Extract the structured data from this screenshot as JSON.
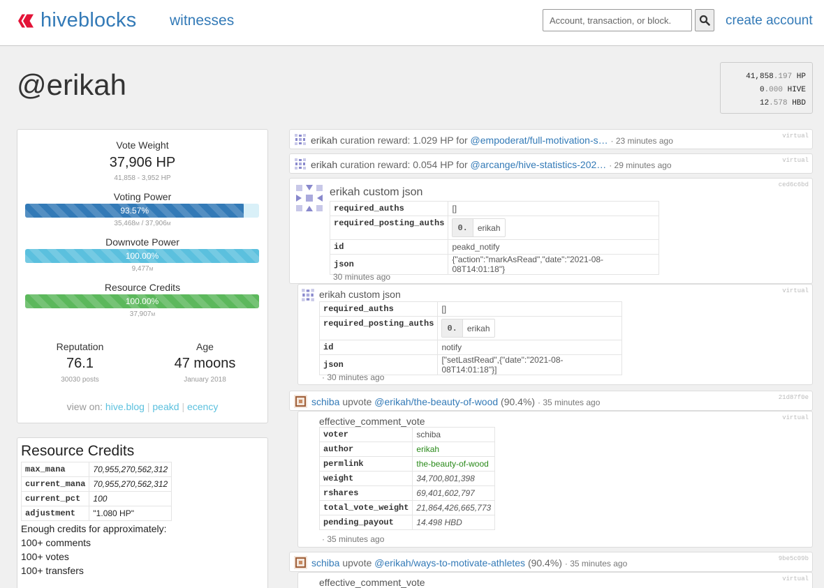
{
  "header": {
    "brand": "hiveblocks",
    "nav_witnesses": "witnesses",
    "search_placeholder": "Account, transaction, or block.",
    "create_account": "create account"
  },
  "account": {
    "username": "@erikah"
  },
  "balances": [
    {
      "int": "41,858",
      "dec": ".197",
      "unit": "HP"
    },
    {
      "int": "0",
      "dec": ".000",
      "unit": "HIVE"
    },
    {
      "int": "12",
      "dec": ".578",
      "unit": "HBD"
    }
  ],
  "stats": {
    "vote_weight_label": "Vote Weight",
    "vote_weight": "37,906 HP",
    "vote_weight_sub": "41,858 - 3,952 HP",
    "voting_power_label": "Voting Power",
    "voting_power_pct": 93.57,
    "voting_power_text": "93.57%",
    "voting_power_sub_a": "35,468",
    "voting_power_sub_b": "37,906",
    "downvote_power_label": "Downvote Power",
    "downvote_power_pct": 100,
    "downvote_power_text": "100.00%",
    "downvote_power_sub": "9,477",
    "rc_label": "Resource Credits",
    "rc_pct": 100,
    "rc_text": "100.00%",
    "rc_sub": "37,907",
    "unit_symbol": "M",
    "reputation_label": "Reputation",
    "reputation": "76.1",
    "posts": "30030 posts",
    "age_label": "Age",
    "age": "47 moons",
    "joined": "January 2018",
    "view_on": "view on:",
    "links": [
      "hive.blog",
      "peakd",
      "ecency"
    ]
  },
  "resource_credits": {
    "title": "Resource Credits",
    "rows": [
      {
        "k": "max_mana",
        "v": "70,955,270,562,312"
      },
      {
        "k": "current_mana",
        "v": "70,955,270,562,312"
      },
      {
        "k": "current_pct",
        "v": "100"
      },
      {
        "k": "adjustment",
        "v": "\"1.080 HP\""
      }
    ],
    "enough": "Enough credits for approximately:",
    "comments": "100+ comments",
    "votes": "100+ votes",
    "transfers": "100+ transfers"
  },
  "ops": {
    "op1": {
      "account": "erikah",
      "text": "curation reward: 1.029 HP for",
      "link": "@empoderat/full-motivation-s…",
      "age": "23 minutes ago",
      "tag": "virtual"
    },
    "op2": {
      "account": "erikah",
      "text": "curation reward: 0.054 HP for",
      "link": "@arcange/hive-statistics-202…",
      "age": "29 minutes ago",
      "tag": "virtual"
    },
    "op3": {
      "account": "erikah",
      "type": "custom json",
      "tag": "ced6c6bd",
      "rows": [
        {
          "k": "required_auths",
          "v": "[]"
        },
        {
          "k": "required_posting_auths",
          "badge_n": "0.",
          "badge_v": "erikah"
        },
        {
          "k": "id",
          "v": "peakd_notify"
        },
        {
          "k": "json",
          "v": "{\"action\":\"markAsRead\",\"date\":\"2021-08-08T14:01:18\"}"
        }
      ],
      "age": "30 minutes ago"
    },
    "op4": {
      "account": "erikah",
      "type": "custom json",
      "tag": "virtual",
      "rows": [
        {
          "k": "required_auths",
          "v": "[]"
        },
        {
          "k": "required_posting_auths",
          "badge_n": "0.",
          "badge_v": "erikah"
        },
        {
          "k": "id",
          "v": "notify"
        },
        {
          "k": "json",
          "v": "[\"setLastRead\",{\"date\":\"2021-08-08T14:01:18\"}]"
        }
      ],
      "age": "· 30 minutes ago"
    },
    "op5": {
      "account": "schiba",
      "action": "upvote",
      "link": "@erikah/the-beauty-of-wood",
      "pct": "(90.4%)",
      "age": "35 minutes ago",
      "tag": "21d87f0e"
    },
    "op6": {
      "title": "effective_comment_vote",
      "tag": "virtual",
      "rows": [
        {
          "k": "voter",
          "v": "schiba"
        },
        {
          "k": "author",
          "v": "erikah"
        },
        {
          "k": "permlink",
          "v": "the-beauty-of-wood"
        },
        {
          "k": "weight",
          "v": "34,700,801,398"
        },
        {
          "k": "rshares",
          "v": "69,401,602,797"
        },
        {
          "k": "total_vote_weight",
          "v": "21,864,426,665,773"
        },
        {
          "k": "pending_payout",
          "v": "14.498 HBD"
        }
      ],
      "age": "· 35 minutes ago"
    },
    "op7": {
      "account": "schiba",
      "action": "upvote",
      "link": "@erikah/ways-to-motivate-athletes",
      "pct": "(90.4%)",
      "age": "35 minutes ago",
      "tag": "9be5c09b"
    },
    "op8": {
      "title": "effective_comment_vote",
      "tag": "virtual"
    }
  }
}
